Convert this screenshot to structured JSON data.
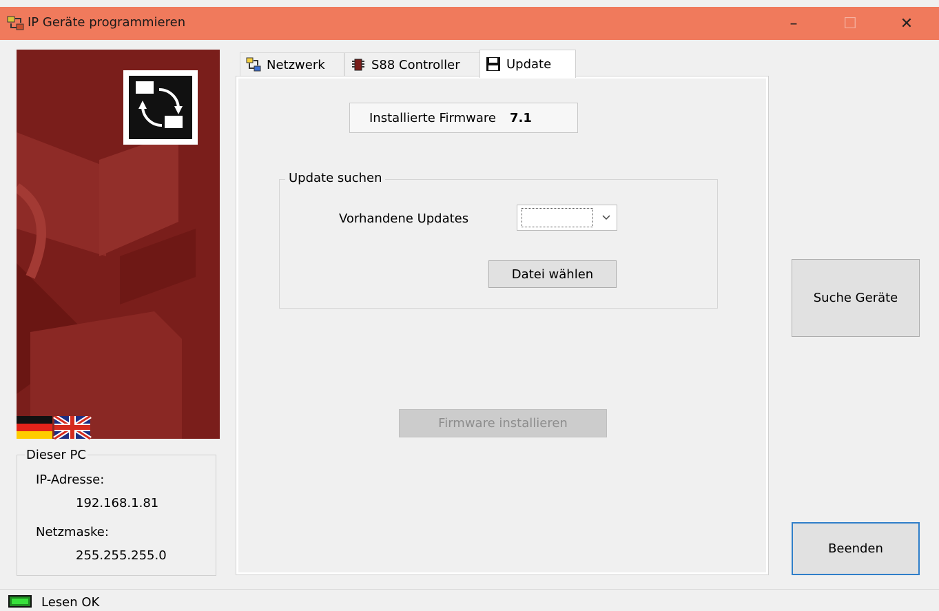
{
  "window": {
    "title": "IP Geräte programmieren",
    "app_icon": "network-tool-icon",
    "controls": {
      "minimize": "–",
      "maximize": "☐",
      "close": "✕"
    }
  },
  "left_panel": {
    "logo_icon": "ip-device-logo-icon",
    "flags": [
      "german-flag-icon",
      "uk-flag-icon"
    ],
    "pc_group": {
      "legend": "Dieser PC",
      "ip_label": "IP-Adresse:",
      "ip_value": "192.168.1.81",
      "mask_label": "Netzmaske:",
      "mask_value": "255.255.255.0"
    }
  },
  "tabs": [
    {
      "label": "Netzwerk",
      "icon": "network-icon",
      "active": false
    },
    {
      "label": "S88 Controller",
      "icon": "controller-icon",
      "active": false
    },
    {
      "label": "Update",
      "icon": "floppy-disk-icon",
      "active": true
    }
  ],
  "update_tab": {
    "firmware_label": "Installierte Firmware",
    "firmware_value": "7.1",
    "search_group": {
      "legend": "Update suchen",
      "updates_label": "Vorhandene Updates",
      "updates_selected": "",
      "choose_file_button": "Datei wählen"
    },
    "install_button": "Firmware installieren"
  },
  "right_buttons": {
    "search_devices": "Suche Geräte",
    "quit": "Beenden"
  },
  "status": {
    "text": "Lesen OK",
    "icon": "status-led-icon"
  },
  "colors": {
    "titlebar": "#f07a5c",
    "left_panel_bg": "#7a1e1b",
    "status_led": "#37e13b",
    "default_button_border": "#2f7ec9"
  }
}
